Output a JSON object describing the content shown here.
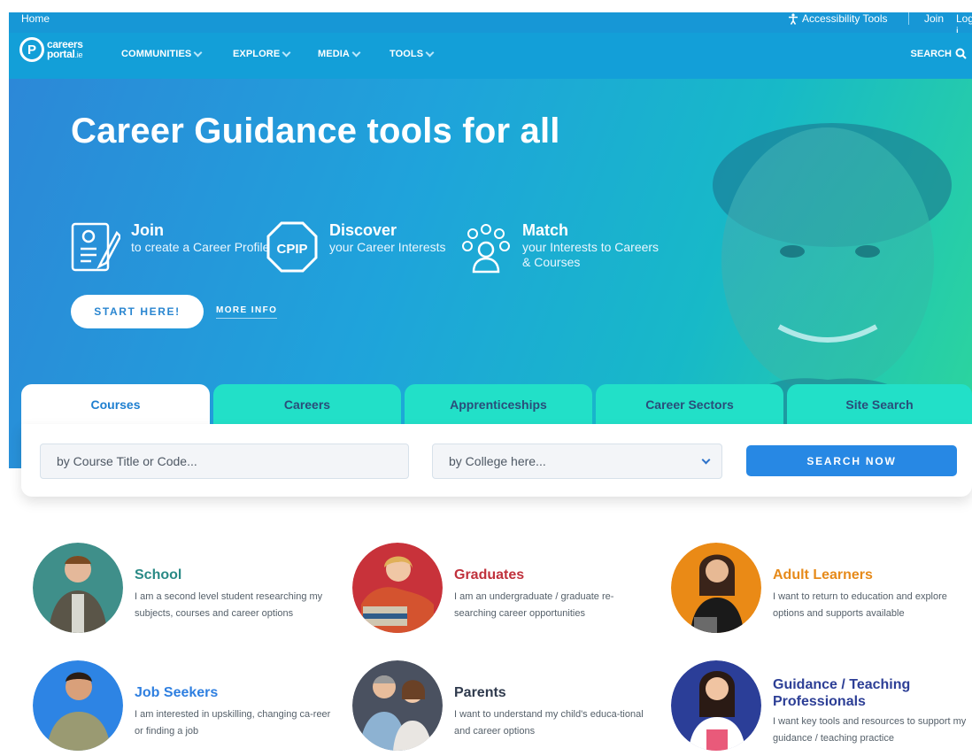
{
  "topbar": {
    "home": "Home",
    "accessibility": "Accessibility Tools",
    "join": "Join",
    "login": "Log i"
  },
  "logo": {
    "line1": "careers",
    "line2": "portal",
    "suffix": ".ie"
  },
  "nav": {
    "items": [
      {
        "label": "COMMUNITIES"
      },
      {
        "label": "EXPLORE"
      },
      {
        "label": "MEDIA"
      },
      {
        "label": "TOOLS"
      }
    ],
    "search_label": "SEARCH"
  },
  "hero": {
    "title": "Career Guidance tools for all",
    "features": [
      {
        "title": "Join",
        "desc": "to create a Career Profile",
        "icon": "profile-document-icon"
      },
      {
        "title": "Discover",
        "desc": "your Career Interests",
        "icon": "cpip-badge-icon"
      },
      {
        "title": "Match",
        "desc": "your Interests to Careers & Courses",
        "icon": "matching-people-icon"
      }
    ],
    "cpip_text": "CPIP",
    "start_label": "START HERE!",
    "more_info_label": "MORE INFO"
  },
  "search": {
    "tabs": [
      {
        "label": "Courses",
        "active": true
      },
      {
        "label": "Careers",
        "active": false
      },
      {
        "label": "Apprenticeships",
        "active": false
      },
      {
        "label": "Career Sectors",
        "active": false
      },
      {
        "label": "Site Search",
        "active": false
      }
    ],
    "course_placeholder": "by Course Title or Code...",
    "college_placeholder": "by College here...",
    "button_label": "SEARCH NOW"
  },
  "audiences": [
    {
      "title": "School",
      "desc": "I am a second level student researching my subjects, courses and career options",
      "color": "#2a8a86"
    },
    {
      "title": "Graduates",
      "desc": "I am an undergraduate / graduate re-searching career opportunities",
      "color": "#c0313c"
    },
    {
      "title": "Adult Learners",
      "desc": "I want to return to education and explore options and supports available",
      "color": "#e68a1a"
    },
    {
      "title": "Job Seekers",
      "desc": "I am interested in upskilling, changing ca-reer or finding a job",
      "color": "#2e7fe0"
    },
    {
      "title": "Parents",
      "desc": "I want to understand my child's educa-tional and career options",
      "color": "#2f3a4d"
    },
    {
      "title": "Guidance / Teaching Professionals",
      "desc": "I want key tools and resources to support my guidance / teaching practice",
      "color": "#2d3f96"
    }
  ],
  "colors": {
    "topbar": "#1797d6",
    "nav": "#139fd8",
    "tab_inactive": "#22e0c8",
    "button": "#2788e4"
  }
}
